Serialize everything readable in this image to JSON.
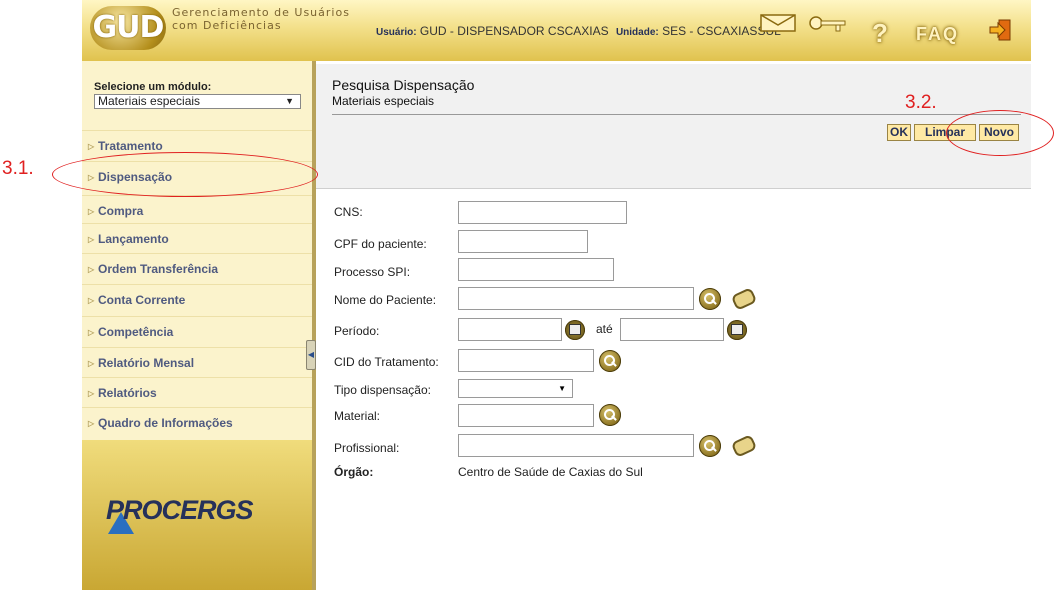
{
  "header": {
    "logo_text": "GUD",
    "app_name_line1": "Gerenciamento de Usuários",
    "app_name_line2": "com Deficiências",
    "user_label": "Usuário:",
    "user_value": "GUD - DISPENSADOR CSCAXIAS",
    "unit_label": "Unidade:",
    "unit_value": "SES - CSCAXIASSUL",
    "help_glyph": "?",
    "faq_label": "FAQ"
  },
  "sidebar": {
    "module_label": "Selecione um módulo:",
    "module_selected": "Materiais especiais",
    "items": [
      {
        "label": "Tratamento"
      },
      {
        "label": "Dispensação"
      },
      {
        "label": "Compra"
      },
      {
        "label": "Lançamento"
      },
      {
        "label": "Ordem Transferência"
      },
      {
        "label": "Conta Corrente"
      },
      {
        "label": "Competência"
      },
      {
        "label": "Relatório Mensal"
      },
      {
        "label": "Relatórios"
      },
      {
        "label": "Quadro de Informações"
      }
    ],
    "brand": "PROCERGS"
  },
  "content": {
    "title": "Pesquisa Dispensação",
    "subtitle": "Materiais especiais",
    "buttons": {
      "ok": "OK",
      "limpar": "Limpar",
      "novo": "Novo"
    },
    "form": {
      "cns_label": "CNS:",
      "cpf_label": "CPF do paciente:",
      "processo_label": "Processo SPI:",
      "nome_label": "Nome do Paciente:",
      "periodo_label": "Período:",
      "ate_label": "até",
      "cid_label": "CID do Tratamento:",
      "tipo_label": "Tipo dispensação:",
      "tipo_value": "",
      "material_label": "Material:",
      "profissional_label": "Profissional:",
      "orgao_label": "Órgão:",
      "orgao_value": "Centro de Saúde de Caxias do Sul"
    }
  },
  "annotations": {
    "step_31": "3.1.",
    "step_32": "3.2."
  },
  "colors": {
    "accent_gold": "#e0c24e",
    "menu_text": "#4f5a80",
    "annotation_red": "#e02020"
  }
}
